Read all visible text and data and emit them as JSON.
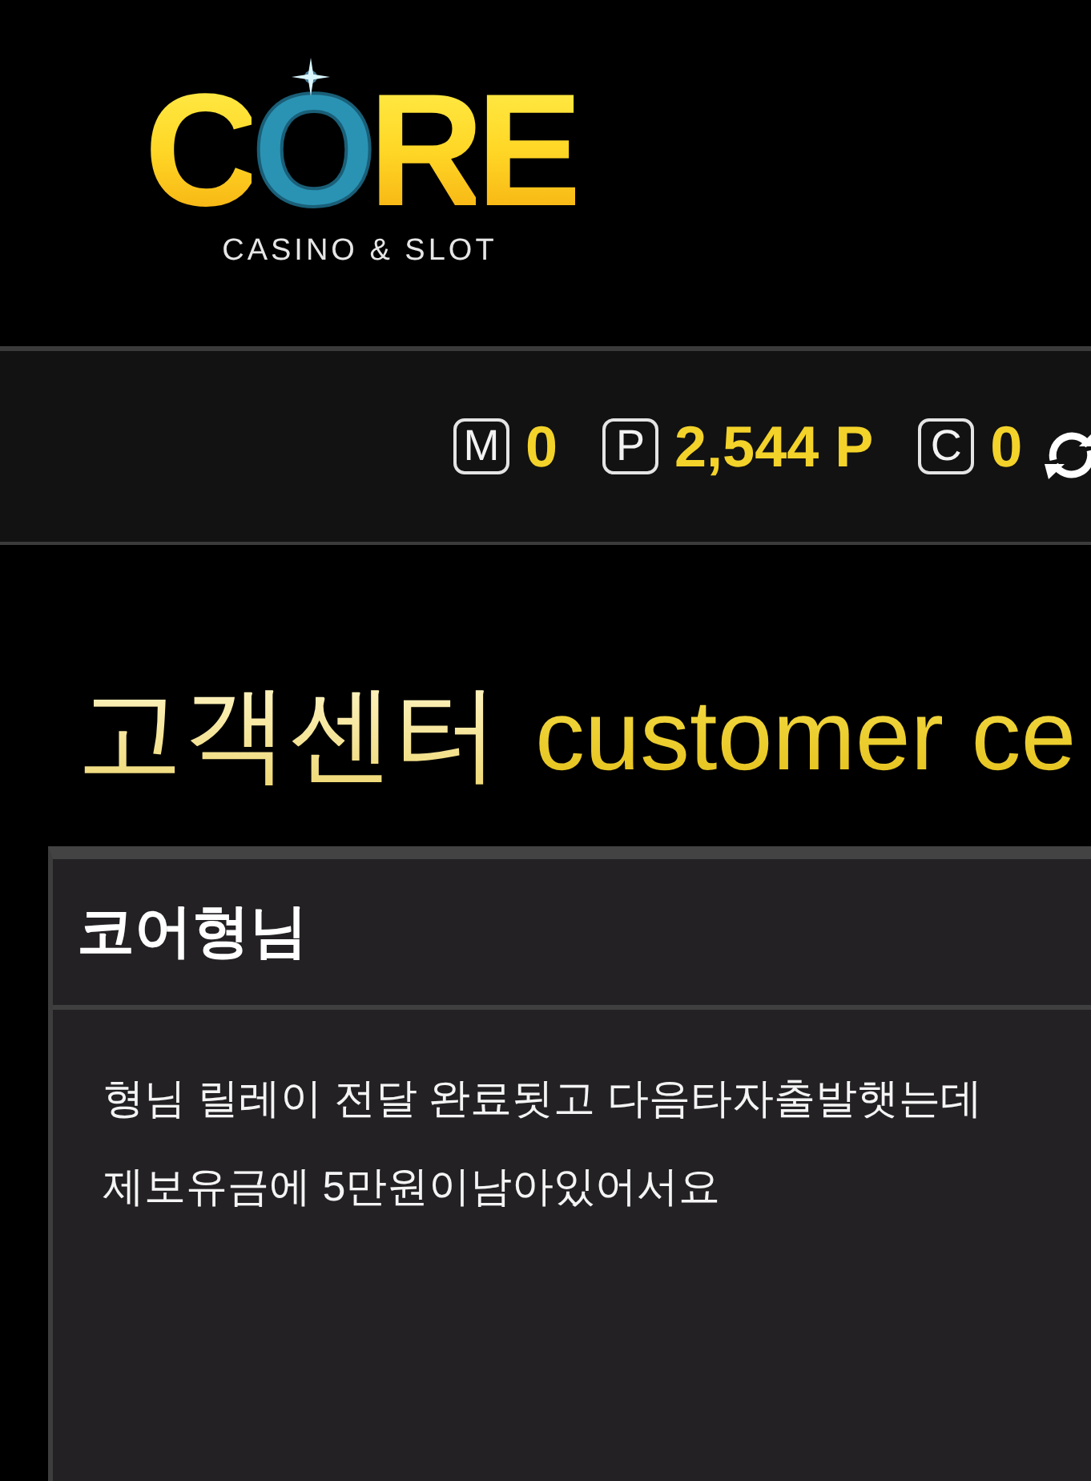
{
  "logo": {
    "wordmark": "CORE",
    "tagline": "CASINO & SLOT"
  },
  "balances": [
    {
      "symbol": "M",
      "amount": "0"
    },
    {
      "symbol": "P",
      "amount": "2,544 P"
    },
    {
      "symbol": "C",
      "amount": "0"
    }
  ],
  "heading": {
    "title": "고객센터",
    "subtitle": "customer ce"
  },
  "message": {
    "title": "코어형님",
    "lines": [
      "형님 릴레이 전달 완료됫고 다음타자출발햇는데",
      "제보유금에 5만원이남아있어서요"
    ]
  }
}
